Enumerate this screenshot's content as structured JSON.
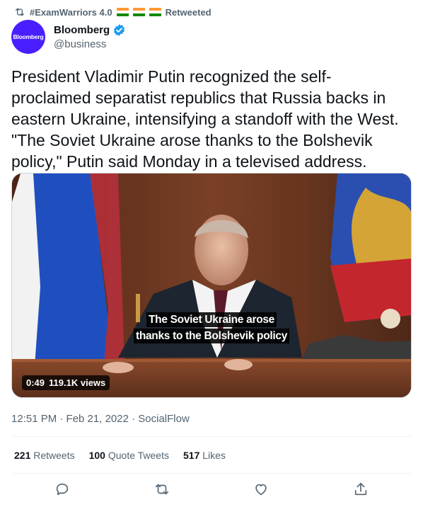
{
  "retweet": {
    "label": "#ExamWarriors 4.0",
    "suffix": "Retweeted",
    "flag_count": 3
  },
  "author": {
    "avatar_text": "Bloomberg",
    "name": "Bloomberg",
    "handle": "@business",
    "avatar_color": "#4a1fff",
    "verified_color": "#1d9bf0"
  },
  "tweet": {
    "text": "President Vladimir Putin recognized the self-\nproclaimed separatist republics that Russia backs in\neastern Ukraine, intensifying a standoff with the West.\n\"The Soviet Ukraine arose thanks to the Bolshevik\npolicy,\" Putin said Monday in a televised address."
  },
  "media": {
    "caption_line1": "The Soviet Ukraine arose",
    "caption_line2": "thanks to the Bolshevik policy",
    "duration": "0:49",
    "views": "119.1K views"
  },
  "meta": {
    "timestamp": "12:51 PM · Feb 21, 2022 · SocialFlow"
  },
  "stats": {
    "retweets_count": "221",
    "retweets_label": "Retweets",
    "quotes_count": "100",
    "quotes_label": "Quote Tweets",
    "likes_count": "517",
    "likes_label": "Likes"
  },
  "actions": {
    "icons": [
      "reply-icon",
      "retweet-icon",
      "like-icon",
      "share-icon"
    ]
  }
}
